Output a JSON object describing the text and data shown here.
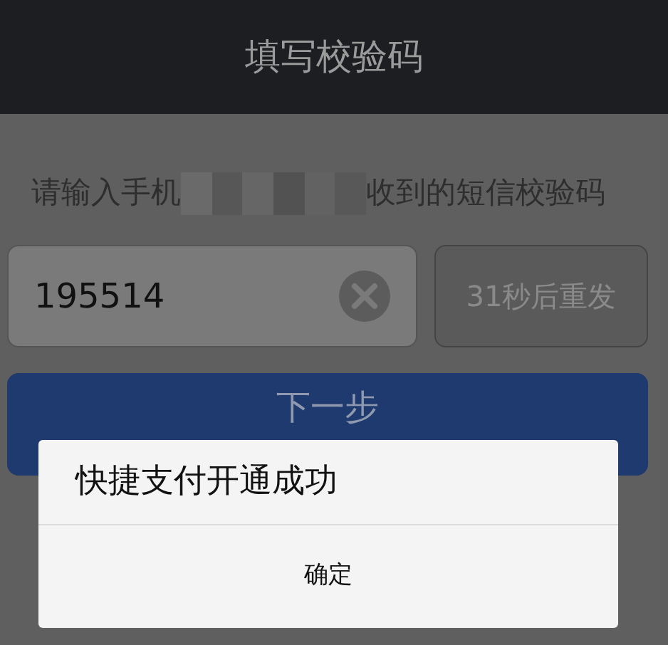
{
  "header": {
    "title": "填写校验码"
  },
  "instruction": {
    "before": "请输入手机",
    "after": "收到的短信校验码"
  },
  "code_field": {
    "value": "195514"
  },
  "resend_button": {
    "label": "31秒后重发",
    "disabled": true
  },
  "next_button": {
    "label": "下一步"
  },
  "dialog": {
    "message": "快捷支付开通成功",
    "button": "确定"
  }
}
